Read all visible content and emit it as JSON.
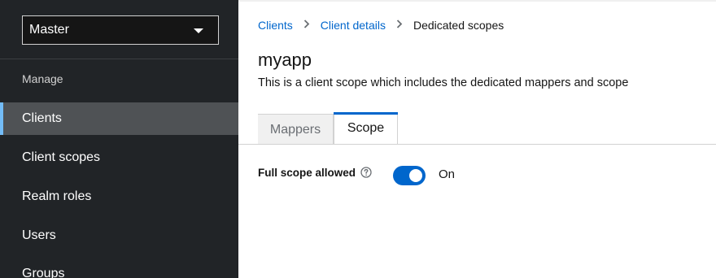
{
  "sidebar": {
    "realm": {
      "selected": "Master"
    },
    "section": "Manage",
    "items": [
      {
        "label": "Clients",
        "active": true
      },
      {
        "label": "Client scopes",
        "active": false
      },
      {
        "label": "Realm roles",
        "active": false
      },
      {
        "label": "Users",
        "active": false
      },
      {
        "label": "Groups",
        "active": false
      }
    ]
  },
  "breadcrumb": {
    "items": [
      "Clients",
      "Client details"
    ],
    "current": "Dedicated scopes"
  },
  "page": {
    "title": "myapp",
    "description": "This is a client scope which includes the dedicated mappers and scope"
  },
  "tabs": [
    {
      "label": "Mappers",
      "active": false
    },
    {
      "label": "Scope",
      "active": true
    }
  ],
  "form": {
    "full_scope": {
      "label": "Full scope allowed",
      "enabled": true,
      "state_label": "On"
    }
  },
  "colors": {
    "accent": "#0066cc",
    "sidebar_bg": "#212427",
    "active_nav_bg": "#4f5255",
    "active_nav_indicator": "#73bcf7"
  },
  "icons": {
    "realm_dropdown": "caret-down-icon",
    "breadcrumb_separator": "chevron-right-icon",
    "help": "question-circle-icon"
  }
}
